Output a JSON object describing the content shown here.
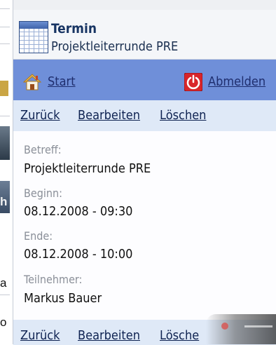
{
  "background": {
    "edge_chars": [
      "h",
      "a",
      "o"
    ]
  },
  "header": {
    "title": "Termin",
    "subtitle": "Projektleiterrunde PRE",
    "icon": "calendar-icon"
  },
  "nav": {
    "start_label": "Start",
    "start_icon": "home-icon",
    "logout_label": "Abmelden",
    "logout_icon": "power-icon"
  },
  "actions": {
    "back": "Zurück",
    "edit": "Bearbeiten",
    "delete": "Löschen"
  },
  "bottom_actions": {
    "back": "Zurück",
    "edit": "Bearbeiten",
    "delete": "Lösche"
  },
  "fields": [
    {
      "label": "Betreff:",
      "value": "Projektleiterrunde PRE"
    },
    {
      "label": "Beginn:",
      "value": "08.12.2008 - 09:30"
    },
    {
      "label": "Ende:",
      "value": "08.12.2008 - 10:00"
    },
    {
      "label": "Teilnehmer:",
      "value": "Markus Bauer"
    }
  ],
  "colors": {
    "nav_bar": "#6f8fd9",
    "action_bar": "#dfe9f7",
    "link": "#1f2e6e",
    "title": "#173463",
    "logout_icon": "#d9252a"
  }
}
